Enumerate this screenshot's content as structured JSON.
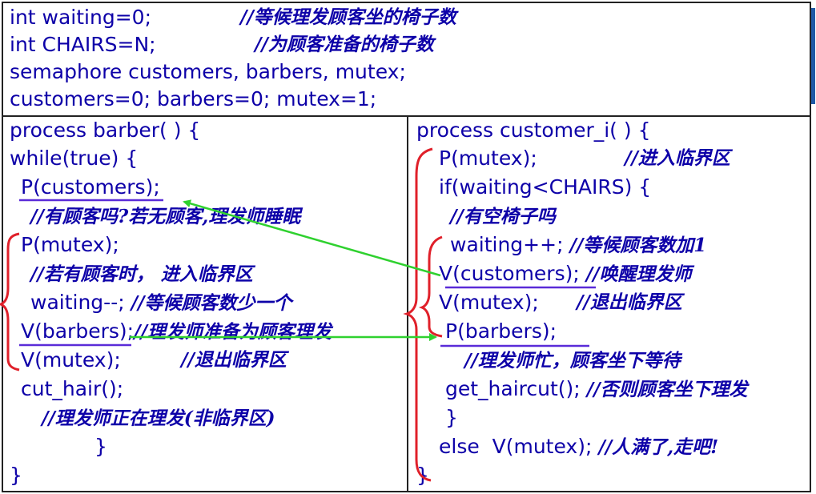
{
  "top": {
    "lines": [
      {
        "code": "int waiting=0;",
        "comment": "//等候理发顾客坐的椅子数"
      },
      {
        "code": "int CHAIRS=N;",
        "comment": "//为顾客准备的椅子数"
      },
      {
        "code": "semaphore customers, barbers, mutex;",
        "comment": ""
      },
      {
        "code": "customers=0; barbers=0; mutex=1;",
        "comment": ""
      }
    ]
  },
  "barber": {
    "lines": [
      {
        "code": "process barber( ) {",
        "comment": ""
      },
      {
        "code": "while(true) {",
        "comment": ""
      },
      {
        "code": "P(customers);",
        "comment": ""
      },
      {
        "code": "",
        "comment": "//有顾客吗?若无顾客,理发师睡眠"
      },
      {
        "code": "P(mutex);",
        "comment": ""
      },
      {
        "code": "",
        "comment": "//若有顾客时， 进入临界区"
      },
      {
        "code": "waiting--; ",
        "comment": "//等候顾客数少一个"
      },
      {
        "code": "V(barbers);",
        "comment": "//理发师准备为顾客理发"
      },
      {
        "code": "V(mutex);",
        "comment": "//退出临界区"
      },
      {
        "code": "cut_hair();",
        "comment": ""
      },
      {
        "code": "",
        "comment": "//理发师正在理发(非临界区)"
      },
      {
        "code": "}",
        "comment": ""
      },
      {
        "code": "}",
        "comment": ""
      }
    ]
  },
  "customer": {
    "lines": [
      {
        "code": "process customer_i( ) {",
        "comment": ""
      },
      {
        "code": "P(mutex);",
        "comment": "//进入临界区"
      },
      {
        "code": "if(waiting<CHAIRS) {",
        "comment": ""
      },
      {
        "code": "",
        "comment": "//有空椅子吗"
      },
      {
        "code": "waiting++; ",
        "comment": "//等候顾客数加1"
      },
      {
        "code": "V(customers); ",
        "comment": "//唤醒理发师"
      },
      {
        "code": "V(mutex);",
        "comment": "//退出临界区"
      },
      {
        "code": "P(barbers);",
        "comment": ""
      },
      {
        "code": "",
        "comment": "//理发师忙，顾客坐下等待"
      },
      {
        "code": "get_haircut(); ",
        "comment": "//否则顾客坐下理发"
      },
      {
        "code": "}",
        "comment": ""
      },
      {
        "code": "else  V(mutex); ",
        "comment": "//人满了,走吧!"
      },
      {
        "code": "}",
        "comment": ""
      }
    ]
  },
  "colors": {
    "text": "#0d00a8",
    "underline": "#5a2bd8",
    "bracket": "#e0202a",
    "arrow": "#2fd12f",
    "border": "#222222",
    "accent": "#1f5aa6"
  }
}
